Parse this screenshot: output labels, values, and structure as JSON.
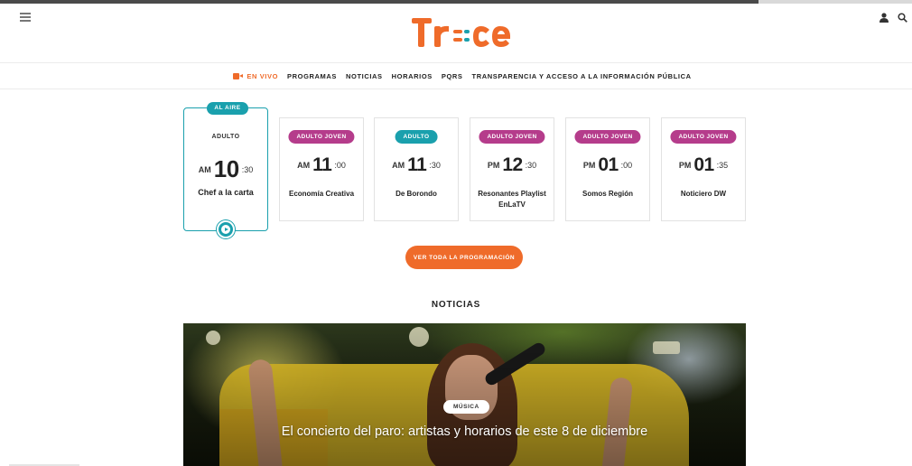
{
  "header": {
    "logo_text": "Tr=ce",
    "brand_color": "#ef6b2a",
    "icons": [
      "menu-icon",
      "user-icon",
      "search-icon"
    ]
  },
  "nav": {
    "live_label": "EN VIVO",
    "items": [
      "PROGRAMAS",
      "NOTICIAS",
      "HORARIOS",
      "PQRS",
      "TRANSPARENCIA Y ACCESO A LA INFORMACIÓN PÚBLICA"
    ]
  },
  "schedule": {
    "on_air_badge": "AL AIRE",
    "cards": [
      {
        "category": "ADULTO",
        "ampm": "AM",
        "hour": "10",
        "minutes": ":30",
        "title": "Chef a la carta",
        "on_air": true
      },
      {
        "category": "ADULTO JOVEN",
        "ampm": "AM",
        "hour": "11",
        "minutes": ":00",
        "title": "Economía Creativa",
        "color": "#b53c8b"
      },
      {
        "category": "ADULTO",
        "ampm": "AM",
        "hour": "11",
        "minutes": ":30",
        "title": "De Borondo",
        "color": "#1aa0ad"
      },
      {
        "category": "ADULTO JOVEN",
        "ampm": "PM",
        "hour": "12",
        "minutes": ":30",
        "title": "Resonantes Playlist EnLaTV",
        "color": "#b53c8b"
      },
      {
        "category": "ADULTO JOVEN",
        "ampm": "PM",
        "hour": "01",
        "minutes": ":00",
        "title": "Somos Región",
        "color": "#b53c8b"
      },
      {
        "category": "ADULTO JOVEN",
        "ampm": "PM",
        "hour": "01",
        "minutes": ":35",
        "title": "Noticiero DW",
        "color": "#b53c8b"
      }
    ],
    "cta_label": "VER TODA LA PROGRAMACIÓN"
  },
  "news": {
    "section_title": "NOTICIAS",
    "hero": {
      "tag": "MÚSICA",
      "headline": "El concierto del paro: artistas y horarios de este 8 de diciembre"
    }
  }
}
